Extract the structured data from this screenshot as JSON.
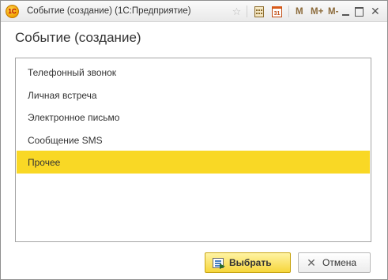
{
  "window": {
    "title": "Событие (создание)  (1С:Предприятие)",
    "logo_text": "1С",
    "calendar_day": "31",
    "m_label": "M",
    "m_plus_label": "M+",
    "m_minus_label": "M-",
    "close_glyph": "✕",
    "star_glyph": "☆"
  },
  "form": {
    "title": "Событие (создание)"
  },
  "list": {
    "items": [
      {
        "label": "Телефонный звонок"
      },
      {
        "label": "Личная встреча"
      },
      {
        "label": "Электронное письмо"
      },
      {
        "label": "Сообщение SMS"
      },
      {
        "label": "Прочее"
      }
    ],
    "selected_index": 4,
    "selected_color": "#f9d825"
  },
  "buttons": {
    "select_label": "Выбрать",
    "cancel_label": "Отмена",
    "cancel_glyph": "✕"
  }
}
